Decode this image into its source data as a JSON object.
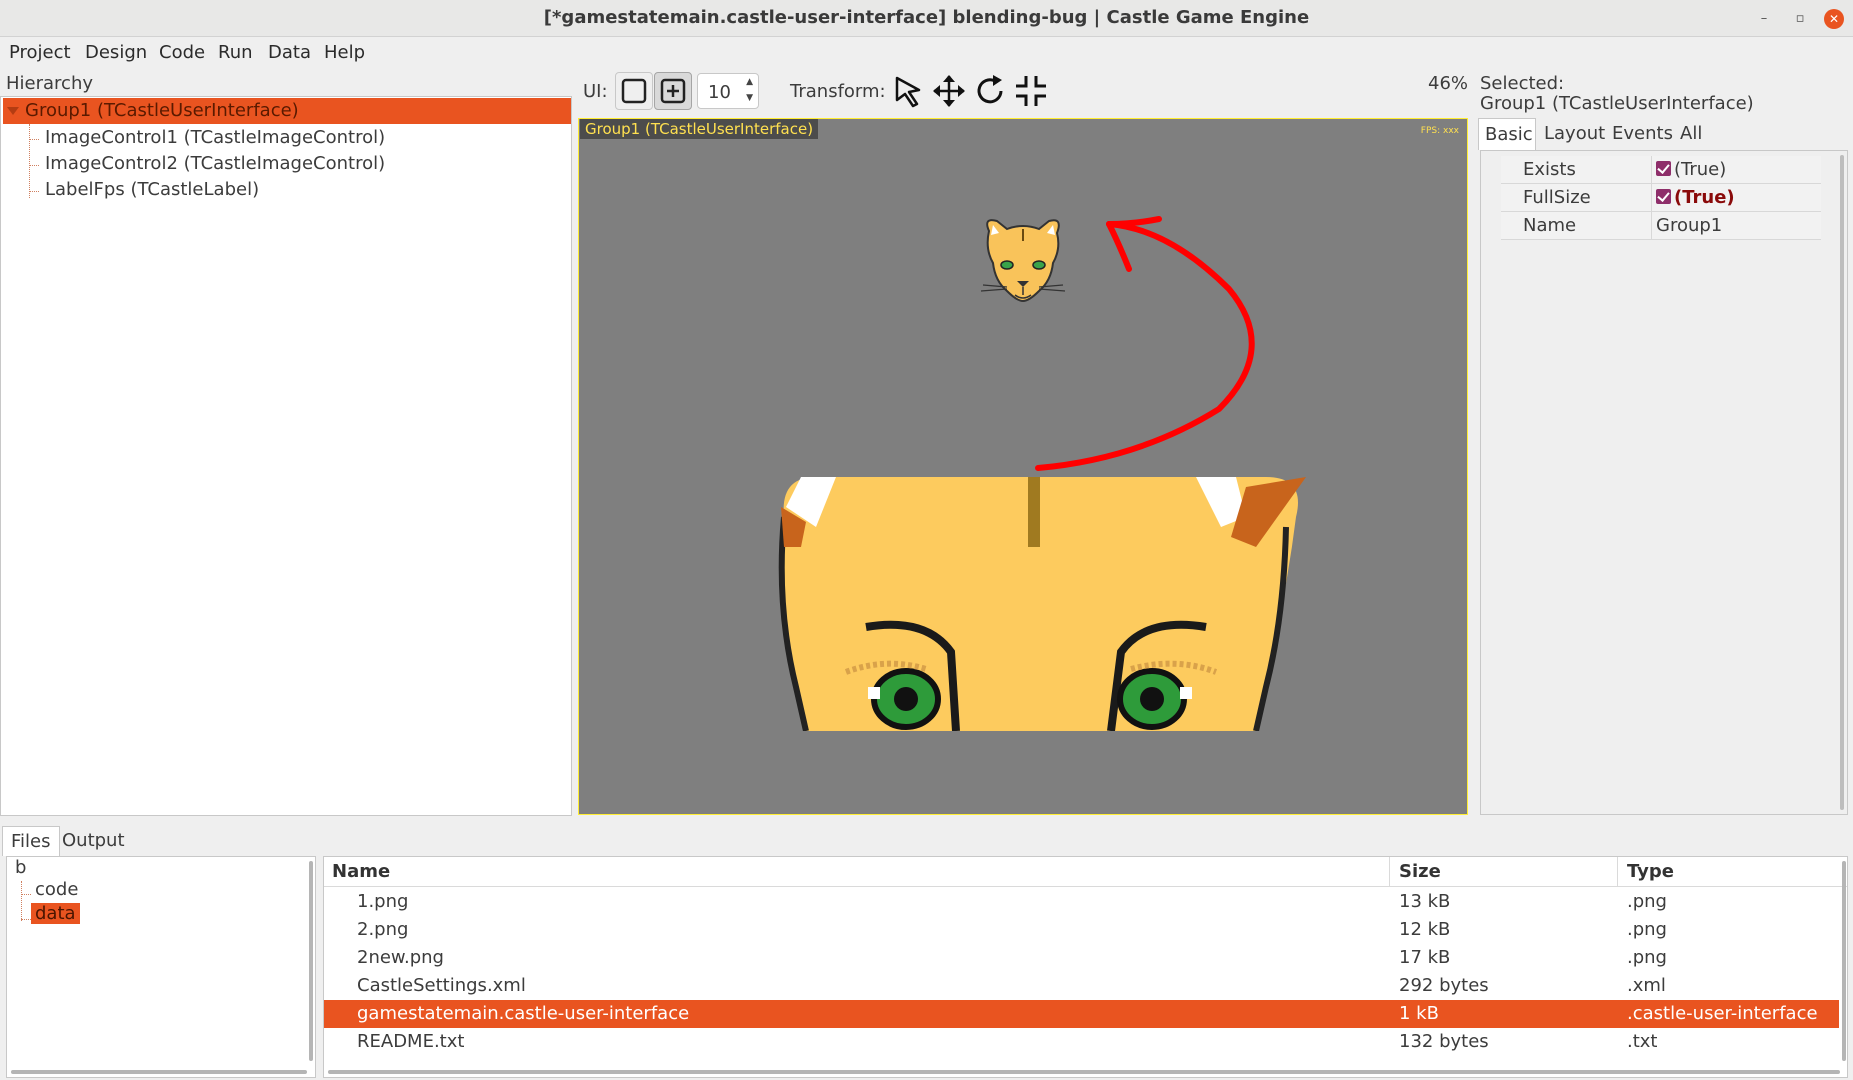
{
  "window": {
    "title": "[*gamestatemain.castle-user-interface] blending-bug | Castle Game Engine",
    "minimize_glyph": "–",
    "maximize_glyph": "▫",
    "close_glyph": "✕"
  },
  "menu": [
    "Project",
    "Design",
    "Code",
    "Run",
    "Data",
    "Help"
  ],
  "hierarchy": {
    "label": "Hierarchy",
    "root": "Group1 (TCastleUserInterface)",
    "children": [
      "ImageControl1 (TCastleImageControl)",
      "ImageControl2 (TCastleImageControl)",
      "LabelFps (TCastleLabel)"
    ]
  },
  "toolbar": {
    "ui_label": "UI:",
    "snap_value": "10",
    "transform_label": "Transform:",
    "zoom": "46%"
  },
  "canvas": {
    "tag": "Group1 (TCastleUserInterface)",
    "fps": "FPS: xxx",
    "bg_color": "#7f7f7f",
    "arrow_color": "#ff0000"
  },
  "inspector": {
    "selected_label": "Selected:",
    "selected_value": "Group1 (TCastleUserInterface)",
    "tabs": [
      "Basic",
      "Layout",
      "Events",
      "All"
    ],
    "properties": [
      {
        "name": "Exists",
        "value": "(True)",
        "checkbox": true,
        "bold": false
      },
      {
        "name": "FullSize",
        "value": "(True)",
        "checkbox": true,
        "bold": true
      },
      {
        "name": "Name",
        "value": "Group1",
        "checkbox": false,
        "bold": false
      }
    ]
  },
  "bottom": {
    "tabs": [
      "Files",
      "Output"
    ],
    "tree": {
      "root": "b",
      "children": [
        "code",
        "data"
      ],
      "selected": "data"
    },
    "columns": [
      "Name",
      "Size",
      "Type"
    ],
    "files": [
      {
        "name": "1.png",
        "size": "13 kB",
        "type": ".png"
      },
      {
        "name": "2.png",
        "size": "12 kB",
        "type": ".png"
      },
      {
        "name": "2new.png",
        "size": "17 kB",
        "type": ".png"
      },
      {
        "name": "CastleSettings.xml",
        "size": "292 bytes",
        "type": ".xml"
      },
      {
        "name": "gamestatemain.castle-user-interface",
        "size": "1 kB",
        "type": ".castle-user-interface"
      },
      {
        "name": "README.txt",
        "size": "132 bytes",
        "type": ".txt"
      }
    ],
    "selected_file": "gamestatemain.castle-user-interface"
  },
  "colors": {
    "accent": "#e95420",
    "checkbox": "#8e2e6a"
  },
  "icons": {
    "select": "cursor-arrow-icon",
    "move": "move-arrows-icon",
    "rotate": "rotate-icon",
    "resize": "resize-icon"
  }
}
